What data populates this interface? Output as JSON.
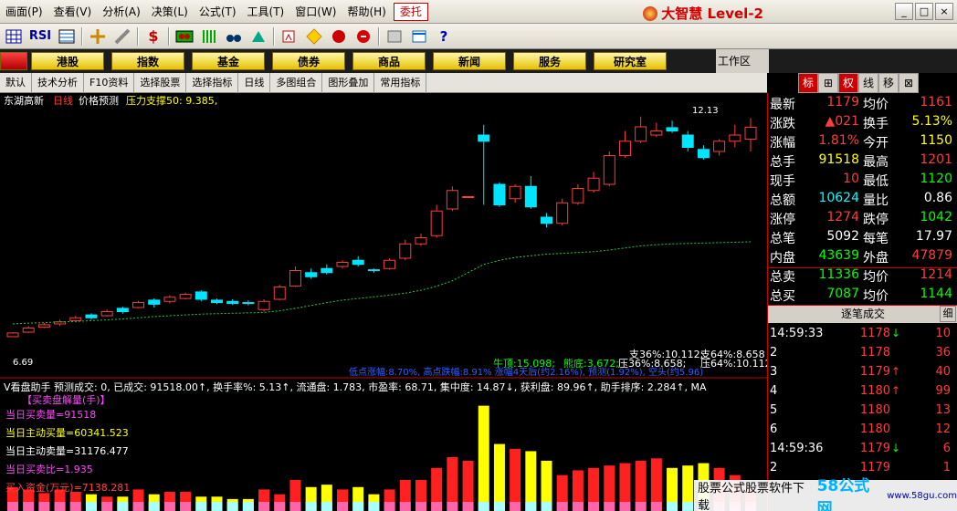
{
  "menu": [
    "画面(P)",
    "查看(V)",
    "分析(A)",
    "决策(L)",
    "公式(T)",
    "工具(T)",
    "窗口(W)",
    "帮助(H)",
    "委托"
  ],
  "brand": "大智慧 Level-2",
  "win_controls": [
    "_",
    "□",
    "×"
  ],
  "toolbar_icons": [
    "chart-grid-icon",
    "RSI",
    "indicator-table-icon",
    "crosshair-icon",
    "ruler-icon",
    "dollar-icon",
    "binocular-icon",
    "bar-stripes-icon",
    "search-binocular-icon",
    "news-icon",
    "flag-icon",
    "warning-diamond-icon",
    "rocket-icon",
    "alert-icon",
    "clipboard-icon",
    "window-icon",
    "help-cursor-icon"
  ],
  "categories": [
    "港股",
    "指数",
    "基金",
    "债券",
    "商品",
    "新闻",
    "服务",
    "研究室"
  ],
  "workzone": "工作区",
  "right_tabs": [
    "标",
    "⊞",
    "权",
    "线",
    "移",
    "⊠"
  ],
  "controls": [
    "默认",
    "技术分析",
    "F10资料",
    "选择股票",
    "选择指标",
    "日线",
    "多图组合",
    "图形叠加",
    "常用指标"
  ],
  "chart_header": {
    "name": "东湖高新",
    "period": "日线",
    "predict": "价格预测",
    "support": "压力支撑50: 9.385,"
  },
  "price_labels": {
    "high": "12.13",
    "low": "6.69"
  },
  "chart_annotations": {
    "niu": "牛顶:15.098;",
    "neng": "熊底:3.672;",
    "ya": "压36%:8.658;",
    "ya2": "压64%:10.112",
    "zhi": "支36%:10.112;",
    "zhi2": "支64%:8.658",
    "blue": "低点涨幅:8.70%,  高点跌幅:8.91%  涨幅4天后(约2.16%), 预测(1.92%), 空头(约5.96)"
  },
  "indicator_line": "V看盘助手 预测成交: 0, 已成交: 91518.00↑, 换手率%: 5.13↑, 流通盘: 1.783, 市盈率: 68.71, 集中度: 14.87↓, 获利盘: 89.96↑, 助手排序: 2.284↑, MA",
  "volume_panel": {
    "title": "【买卖盘解量(手)】",
    "l1": "当日买卖量=91518",
    "l2": "当日主动买量=60341.523",
    "l3": "当日主动卖量=31176.477",
    "l4": "当日买卖比=1.935",
    "l5": "买入资金(万元)=7138.281"
  },
  "quote": [
    {
      "l": "最新",
      "v": "1179",
      "v_color": "#ff3b3b",
      "l2": "均价",
      "v2": "1161",
      "v2_color": "#ff3b3b"
    },
    {
      "l": "涨跌",
      "v": "▲021",
      "v_color": "#ff3b3b",
      "l2": "换手",
      "v2": "5.13%",
      "v2_color": "#ffff00"
    },
    {
      "l": "涨幅",
      "v": "1.81%",
      "v_color": "#ff3b3b",
      "l2": "今开",
      "v2": "1150",
      "v2_color": "#ffff00"
    },
    {
      "l": "总手",
      "v": "91518",
      "v_color": "#ffff00",
      "l2": "最高",
      "v2": "1201",
      "v2_color": "#ff3b3b"
    },
    {
      "l": "现手",
      "v": "10",
      "v_color": "#ff3b3b",
      "l2": "最低",
      "v2": "1120",
      "v2_color": "#00ff00"
    },
    {
      "l": "总额",
      "v": "10624",
      "v_color": "#00ffff",
      "l2": "量比",
      "v2": "0.86",
      "v2_color": "#ffffff"
    },
    {
      "l": "涨停",
      "v": "1274",
      "v_color": "#ff3b3b",
      "l2": "跌停",
      "v2": "1042",
      "v2_color": "#00ff00"
    },
    {
      "l": "总笔",
      "v": "5092",
      "v_color": "#ffffff",
      "l2": "每笔",
      "v2": "17.97",
      "v2_color": "#ffffff"
    },
    {
      "l": "内盘",
      "v": "43639",
      "v_color": "#00ff00",
      "l2": "外盘",
      "v2": "47879",
      "v2_color": "#ff3b3b"
    },
    {
      "l": "总卖",
      "v": "11336",
      "v_color": "#00ff00",
      "l2": "均价",
      "v2": "1214",
      "v2_color": "#ff3b3b"
    },
    {
      "l": "总买",
      "v": "7087",
      "v_color": "#00ff00",
      "l2": "均价",
      "v2": "1144",
      "v2_color": "#00ff00"
    }
  ],
  "trades_header": {
    "title": "逐笔成交",
    "btn": "细"
  },
  "trades": [
    {
      "t": "14:59:33",
      "p": "1178",
      "a": "↓",
      "ac": "#00ff00",
      "v": "10"
    },
    {
      "t": "2",
      "p": "1178",
      "a": "",
      "ac": "#ff3b3b",
      "v": "36"
    },
    {
      "t": "3",
      "p": "1179",
      "a": "↑",
      "ac": "#ff3b3b",
      "v": "40"
    },
    {
      "t": "4",
      "p": "1180",
      "a": "↑",
      "ac": "#ff3b3b",
      "v": "99"
    },
    {
      "t": "5",
      "p": "1180",
      "a": "",
      "ac": "#ff3b3b",
      "v": "13"
    },
    {
      "t": "6",
      "p": "1180",
      "a": "",
      "ac": "#ff3b3b",
      "v": "12"
    },
    {
      "t": "14:59:36",
      "p": "1179",
      "a": "↓",
      "ac": "#00ff00",
      "v": "6"
    },
    {
      "t": "2",
      "p": "1179",
      "a": "",
      "ac": "#ff3b3b",
      "v": "1"
    }
  ],
  "watermark": {
    "text": "股票公式股票软件下载",
    "logo": "58公式网",
    "url": "www.58gu.com"
  },
  "chart_data": {
    "type": "candlestick",
    "candles": [
      {
        "o": 6.69,
        "c": 6.78,
        "h": 6.8,
        "l": 6.69,
        "up": true
      },
      {
        "o": 6.8,
        "c": 6.9,
        "h": 6.95,
        "l": 6.78,
        "up": true
      },
      {
        "o": 6.92,
        "c": 6.98,
        "h": 7.02,
        "l": 6.9,
        "up": true
      },
      {
        "o": 7.0,
        "c": 7.05,
        "h": 7.1,
        "l": 6.95,
        "up": true
      },
      {
        "o": 7.08,
        "c": 7.15,
        "h": 7.2,
        "l": 7.05,
        "up": true
      },
      {
        "o": 7.22,
        "c": 7.15,
        "h": 7.26,
        "l": 7.1,
        "up": false
      },
      {
        "o": 7.2,
        "c": 7.3,
        "h": 7.35,
        "l": 7.18,
        "up": true
      },
      {
        "o": 7.38,
        "c": 7.3,
        "h": 7.42,
        "l": 7.25,
        "up": false
      },
      {
        "o": 7.4,
        "c": 7.52,
        "h": 7.56,
        "l": 7.38,
        "up": true
      },
      {
        "o": 7.58,
        "c": 7.48,
        "h": 7.62,
        "l": 7.4,
        "up": false
      },
      {
        "o": 7.55,
        "c": 7.65,
        "h": 7.7,
        "l": 7.5,
        "up": true
      },
      {
        "o": 7.62,
        "c": 7.72,
        "h": 7.76,
        "l": 7.6,
        "up": true
      },
      {
        "o": 7.78,
        "c": 7.6,
        "h": 7.82,
        "l": 7.55,
        "up": false
      },
      {
        "o": 7.58,
        "c": 7.52,
        "h": 7.62,
        "l": 7.48,
        "up": false
      },
      {
        "o": 7.55,
        "c": 7.5,
        "h": 7.6,
        "l": 7.46,
        "up": false
      },
      {
        "o": 7.52,
        "c": 7.5,
        "h": 7.58,
        "l": 7.45,
        "up": false
      },
      {
        "o": 7.35,
        "c": 7.55,
        "h": 7.6,
        "l": 7.3,
        "up": true
      },
      {
        "o": 7.6,
        "c": 7.9,
        "h": 7.95,
        "l": 7.58,
        "up": true
      },
      {
        "o": 7.92,
        "c": 8.3,
        "h": 8.4,
        "l": 7.9,
        "up": true
      },
      {
        "o": 8.25,
        "c": 8.15,
        "h": 8.35,
        "l": 8.1,
        "up": false
      },
      {
        "o": 8.35,
        "c": 8.25,
        "h": 8.45,
        "l": 8.2,
        "up": false
      },
      {
        "o": 8.4,
        "c": 8.5,
        "h": 8.55,
        "l": 8.35,
        "up": true
      },
      {
        "o": 8.55,
        "c": 8.45,
        "h": 8.65,
        "l": 8.4,
        "up": false
      },
      {
        "o": 8.32,
        "c": 8.3,
        "h": 8.35,
        "l": 8.25,
        "up": false
      },
      {
        "o": 8.35,
        "c": 8.55,
        "h": 8.6,
        "l": 8.32,
        "up": true
      },
      {
        "o": 8.6,
        "c": 8.95,
        "h": 9.05,
        "l": 8.55,
        "up": true
      },
      {
        "o": 8.95,
        "c": 9.1,
        "h": 9.2,
        "l": 8.9,
        "up": true
      },
      {
        "o": 9.15,
        "c": 9.75,
        "h": 9.9,
        "l": 9.1,
        "up": true
      },
      {
        "o": 9.8,
        "c": 10.25,
        "h": 10.35,
        "l": 9.75,
        "up": true
      },
      {
        "o": 10.1,
        "c": 10.1,
        "h": 10.1,
        "l": 10.1,
        "up": true
      },
      {
        "o": 11.45,
        "c": 11.6,
        "h": 11.85,
        "l": 9.9,
        "up": false
      },
      {
        "o": 10.4,
        "c": 9.9,
        "h": 10.45,
        "l": 9.85,
        "up": false
      },
      {
        "o": 10.05,
        "c": 10.35,
        "h": 10.4,
        "l": 9.95,
        "up": true
      },
      {
        "o": 10.35,
        "c": 9.85,
        "h": 10.6,
        "l": 9.8,
        "up": false
      },
      {
        "o": 9.6,
        "c": 9.45,
        "h": 9.7,
        "l": 9.35,
        "up": false
      },
      {
        "o": 9.45,
        "c": 9.95,
        "h": 10.05,
        "l": 9.4,
        "up": true
      },
      {
        "o": 9.95,
        "c": 10.3,
        "h": 10.4,
        "l": 9.9,
        "up": true
      },
      {
        "o": 10.25,
        "c": 10.55,
        "h": 10.7,
        "l": 10.2,
        "up": true
      },
      {
        "o": 10.4,
        "c": 11.1,
        "h": 11.2,
        "l": 10.35,
        "up": true
      },
      {
        "o": 11.1,
        "c": 11.45,
        "h": 11.7,
        "l": 11.05,
        "up": true
      },
      {
        "o": 11.45,
        "c": 11.8,
        "h": 12.05,
        "l": 11.4,
        "up": true
      },
      {
        "o": 11.6,
        "c": 11.7,
        "h": 11.9,
        "l": 11.55,
        "up": true
      },
      {
        "o": 11.78,
        "c": 11.7,
        "h": 11.95,
        "l": 11.65,
        "up": false
      },
      {
        "o": 11.6,
        "c": 11.3,
        "h": 11.7,
        "l": 11.2,
        "up": false
      },
      {
        "o": 11.25,
        "c": 11.05,
        "h": 11.35,
        "l": 11.0,
        "up": false
      },
      {
        "o": 11.2,
        "c": 11.45,
        "h": 11.5,
        "l": 11.1,
        "up": true
      },
      {
        "o": 11.45,
        "c": 11.6,
        "h": 11.85,
        "l": 11.3,
        "up": true
      },
      {
        "o": 11.5,
        "c": 11.79,
        "h": 12.01,
        "l": 11.2,
        "up": true
      }
    ],
    "support_line": [
      7.0,
      7.02,
      7.03,
      7.05,
      7.06,
      7.08,
      7.1,
      7.12,
      7.15,
      7.18,
      7.2,
      7.22,
      7.24,
      7.25,
      7.26,
      7.27,
      7.28,
      7.32,
      7.38,
      7.45,
      7.52,
      7.58,
      7.62,
      7.66,
      7.7,
      7.75,
      7.82,
      7.92,
      8.05,
      8.25,
      8.45,
      8.55,
      8.62,
      8.66,
      8.7,
      8.72,
      8.74,
      8.76,
      8.8,
      8.85,
      8.9,
      8.93,
      8.95,
      8.96,
      8.97,
      8.98,
      8.99,
      9.0
    ],
    "volume": [
      20,
      18,
      15,
      18,
      16,
      14,
      12,
      12,
      18,
      14,
      16,
      16,
      12,
      12,
      10,
      10,
      18,
      14,
      26,
      20,
      22,
      18,
      20,
      14,
      18,
      26,
      26,
      36,
      45,
      42,
      88,
      56,
      52,
      50,
      42,
      30,
      34,
      36,
      38,
      40,
      42,
      44,
      36,
      38,
      40,
      36,
      30,
      22
    ],
    "ylim": [
      6.4,
      12.4
    ]
  }
}
